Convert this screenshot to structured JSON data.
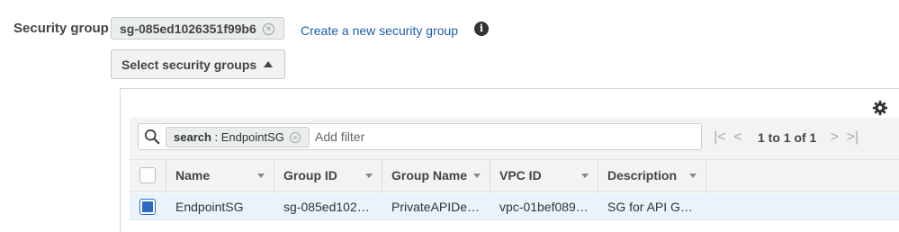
{
  "form": {
    "label": "Security group",
    "selected_token": "sg-085ed1026351f99b6",
    "create_link": "Create a new security group",
    "info_icon_glyph": "i",
    "select_button": "Select security groups"
  },
  "filter": {
    "token_key": "search",
    "token_sep": " : ",
    "token_value": "EndpointSG",
    "placeholder": "Add filter"
  },
  "pagination": {
    "first": "|<",
    "prev": "<",
    "text": "1 to 1 of 1",
    "next": ">",
    "last": ">|"
  },
  "table": {
    "columns": [
      "Name",
      "Group ID",
      "Group Name",
      "VPC ID",
      "Description"
    ],
    "rows": [
      {
        "selected": true,
        "cells": [
          "EndpointSG",
          "sg-085ed102…",
          "PrivateAPIDe…",
          "vpc-01bef089…",
          "SG for API G…"
        ]
      }
    ]
  },
  "icons": {
    "info": "info-icon",
    "settings": "gear-icon",
    "search": "search-icon",
    "token_close": "close-circle-icon"
  },
  "colors": {
    "link": "#1b5fa8",
    "selected_row": "#eaf3fb",
    "checkbox_checked": "#2b6cc4"
  }
}
